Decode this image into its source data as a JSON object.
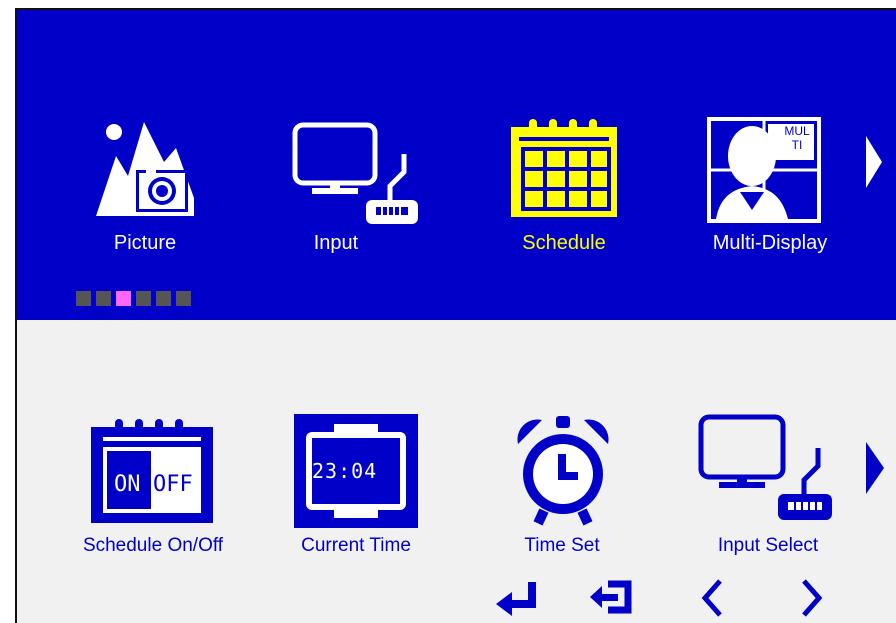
{
  "top_menu": {
    "items": [
      {
        "label": "Picture",
        "icon": "picture-icon"
      },
      {
        "label": "Input",
        "icon": "input-icon"
      },
      {
        "label": "Schedule",
        "icon": "schedule-icon",
        "active": true
      },
      {
        "label": "Multi-Display",
        "icon": "multi-display-icon"
      }
    ],
    "multi_badge": "MUL TI",
    "next_icon": "chevron-right-icon",
    "page_dots": {
      "count": 6,
      "active_index": 2
    }
  },
  "sub_menu": {
    "items": [
      {
        "label": "Schedule On/Off",
        "icon": "schedule-onoff-icon"
      },
      {
        "label": "Current Time",
        "icon": "current-time-icon"
      },
      {
        "label": "Time Set",
        "icon": "alarm-clock-icon"
      },
      {
        "label": "Input Select",
        "icon": "input-select-icon"
      }
    ],
    "on_text": "ON",
    "off_text": "OFF",
    "clock_text": "23:04",
    "next_icon": "chevron-right-icon"
  },
  "controls": [
    "enter-icon",
    "exit-icon",
    "left-icon",
    "right-icon"
  ],
  "colors": {
    "primary": "#0000c8",
    "highlight": "#ffff00",
    "dot_active": "#ff66ff",
    "dot": "#555555",
    "panel": "#f1f1f1"
  }
}
